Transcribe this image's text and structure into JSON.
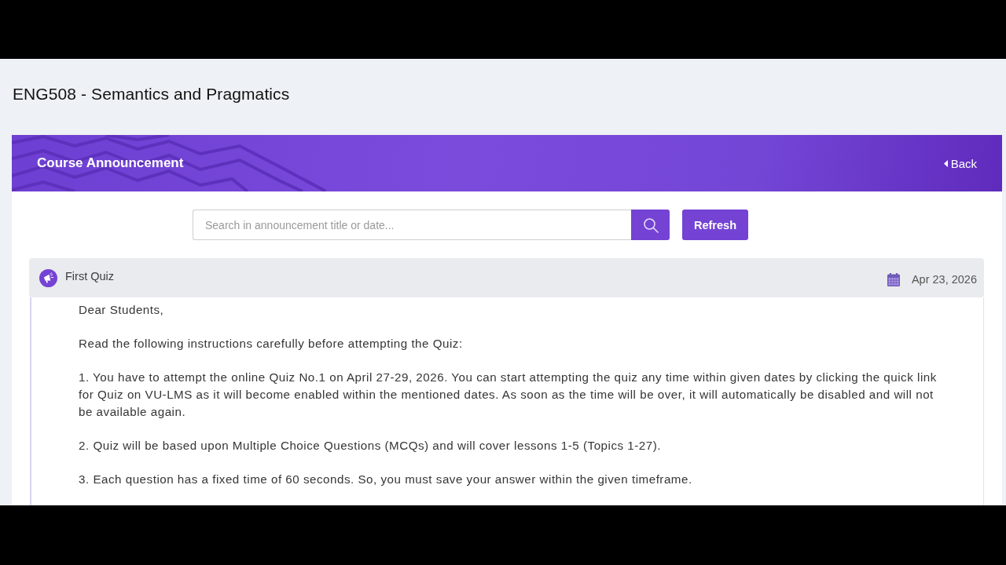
{
  "page": {
    "title": "ENG508 - Semantics and Pragmatics"
  },
  "banner": {
    "title": "Course Announcement",
    "back_label": "Back"
  },
  "search": {
    "placeholder": "Search in announcement title or date...",
    "refresh_label": "Refresh"
  },
  "announcements": [
    {
      "title": "First Quiz",
      "date": "Apr 23, 2026",
      "paragraphs": [
        "Dear Students,",
        "Read the following instructions carefully before attempting the Quiz:",
        "1. You have to attempt the online Quiz No.1 on April 27-29, 2026. You can start attempting the quiz any time within given dates by clicking the quick link for Quiz on VU-LMS as it will become enabled within the mentioned dates. As soon as the time will be over, it will automatically be disabled and will not be available again.",
        "2. Quiz will be based upon Multiple Choice Questions (MCQs) and will cover lessons 1-5 (Topics 1-27).",
        "3. Each question has a fixed time of 60 seconds. So, you must save your answer within the given timeframe."
      ]
    }
  ]
}
